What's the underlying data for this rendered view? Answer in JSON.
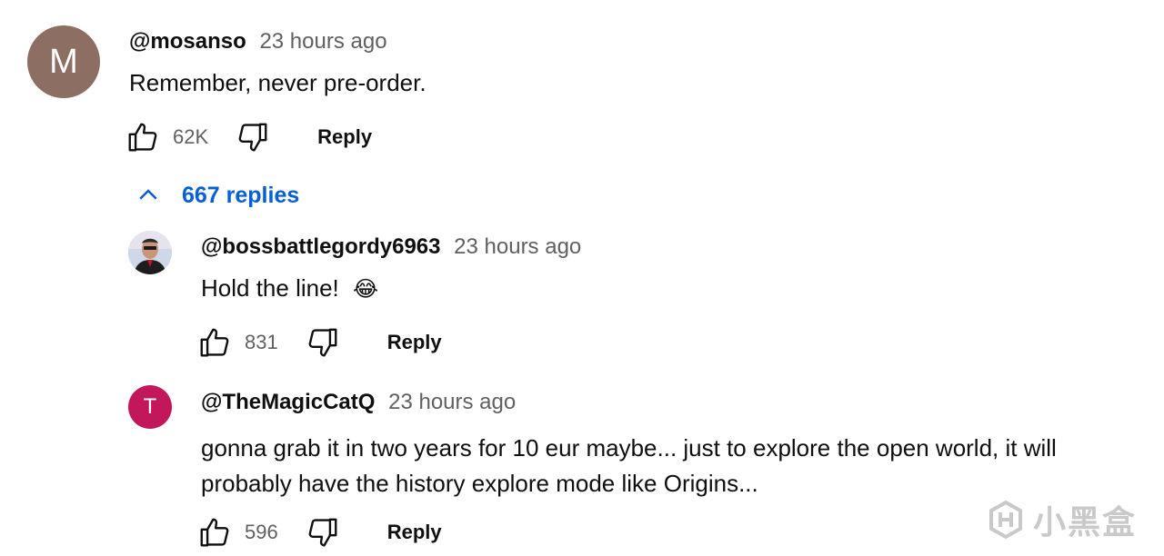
{
  "comments": [
    {
      "avatar_letter": "M",
      "avatar_color": "#8d6e63",
      "author": "@mosanso",
      "time": "23 hours ago",
      "text": "Remember, never pre-order.",
      "likes": "62K",
      "reply_label": "Reply"
    }
  ],
  "replies_toggle": {
    "label": "667 replies",
    "icon": "chevron-up-icon",
    "color": "#065fd4"
  },
  "replies": [
    {
      "avatar": "profile-photo",
      "author": "@bossbattlegordy6963",
      "time": "23 hours ago",
      "text": "Hold the line!",
      "emoji": "😂",
      "likes": "831",
      "reply_label": "Reply"
    },
    {
      "avatar_letter": "T",
      "avatar_color": "#c2185b",
      "author": "@TheMagicCatQ",
      "time": "23 hours ago",
      "text_line1": "gonna grab it in two years for 10 eur maybe... just to explore the open world, it will",
      "text_line2": "probably have the history explore mode like Origins...",
      "likes": "596",
      "reply_label": "Reply"
    }
  ],
  "watermark": {
    "text": "小黑盒",
    "icon": "heybox-logo-icon"
  }
}
